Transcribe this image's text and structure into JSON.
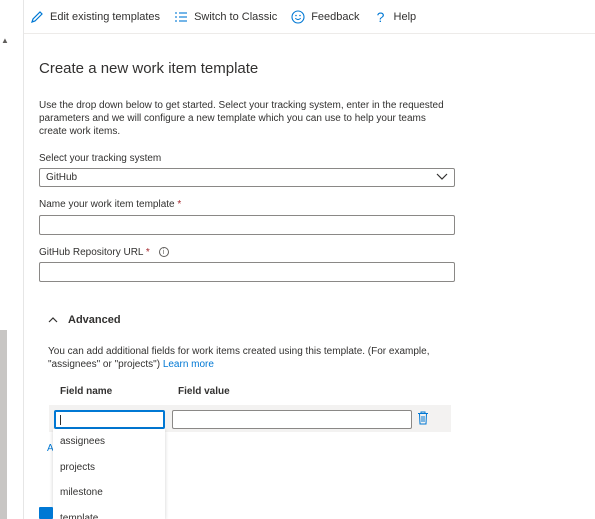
{
  "toolbar": {
    "edit_label": "Edit existing templates",
    "switch_label": "Switch to Classic",
    "feedback_label": "Feedback",
    "help_label": "Help"
  },
  "form": {
    "title": "Create a new work item template",
    "description": "Use the drop down below to get started. Select your tracking system, enter in the requested parameters and we will configure a new template which you can use to help your teams create work items.",
    "tracking_label": "Select your tracking system",
    "tracking_value": "GitHub",
    "template_name_label": "Name your work item template",
    "repo_url_label": "GitHub Repository URL",
    "required_mark": "*",
    "info_glyph": "i"
  },
  "advanced": {
    "header": "Advanced",
    "description": "You can add additional fields for work items created using this template. (For example, \"assignees\" or \"projects\")",
    "learn_more": "Learn more",
    "field_name_header": "Field name",
    "field_value_header": "Field value",
    "field_name_value": "",
    "field_value_value": "",
    "hidden_link_char": "A"
  },
  "suggestions": [
    "assignees",
    "projects",
    "milestone",
    "template"
  ],
  "colors": {
    "accent": "#0078d4",
    "required": "#a4262c",
    "row_bg": "#f3f2f1"
  },
  "icons": {
    "edit": "pencil-icon",
    "switch": "list-icon",
    "feedback": "smiley-icon",
    "help": "question-icon",
    "dropdown": "chevron-down-icon",
    "advanced": "chevron-up-icon",
    "delete": "trash-icon",
    "info": "info-icon"
  }
}
